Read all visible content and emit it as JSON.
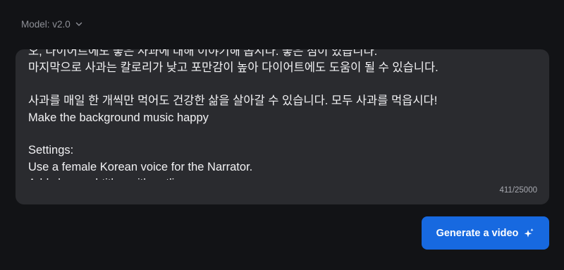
{
  "model_selector": {
    "label": "Model: v2.0"
  },
  "prompt": {
    "text": "오, 다이어트에도 좋은 사과에 대해 이야기해 봅시다. 좋은 점이 있습니다.\n마지막으로 사과는 칼로리가 낮고 포만감이 높아 다이어트에도 도움이 될 수 있습니다.\n\n사과를 매일 한 개씩만 먹어도 건강한 삶을 살아갈 수 있습니다. 모두 사과를 먹읍시다!\nMake the background music happy\n\nSettings:\nUse a female Korean voice for the Narrator.\nAdd clean subtitles with outline",
    "counter": "411/25000"
  },
  "generate_button": {
    "label": "Generate a video",
    "icon": "sparkle-icon"
  },
  "colors": {
    "background": "#121316",
    "panel": "#2a2b2f",
    "accent": "#1769e0"
  }
}
